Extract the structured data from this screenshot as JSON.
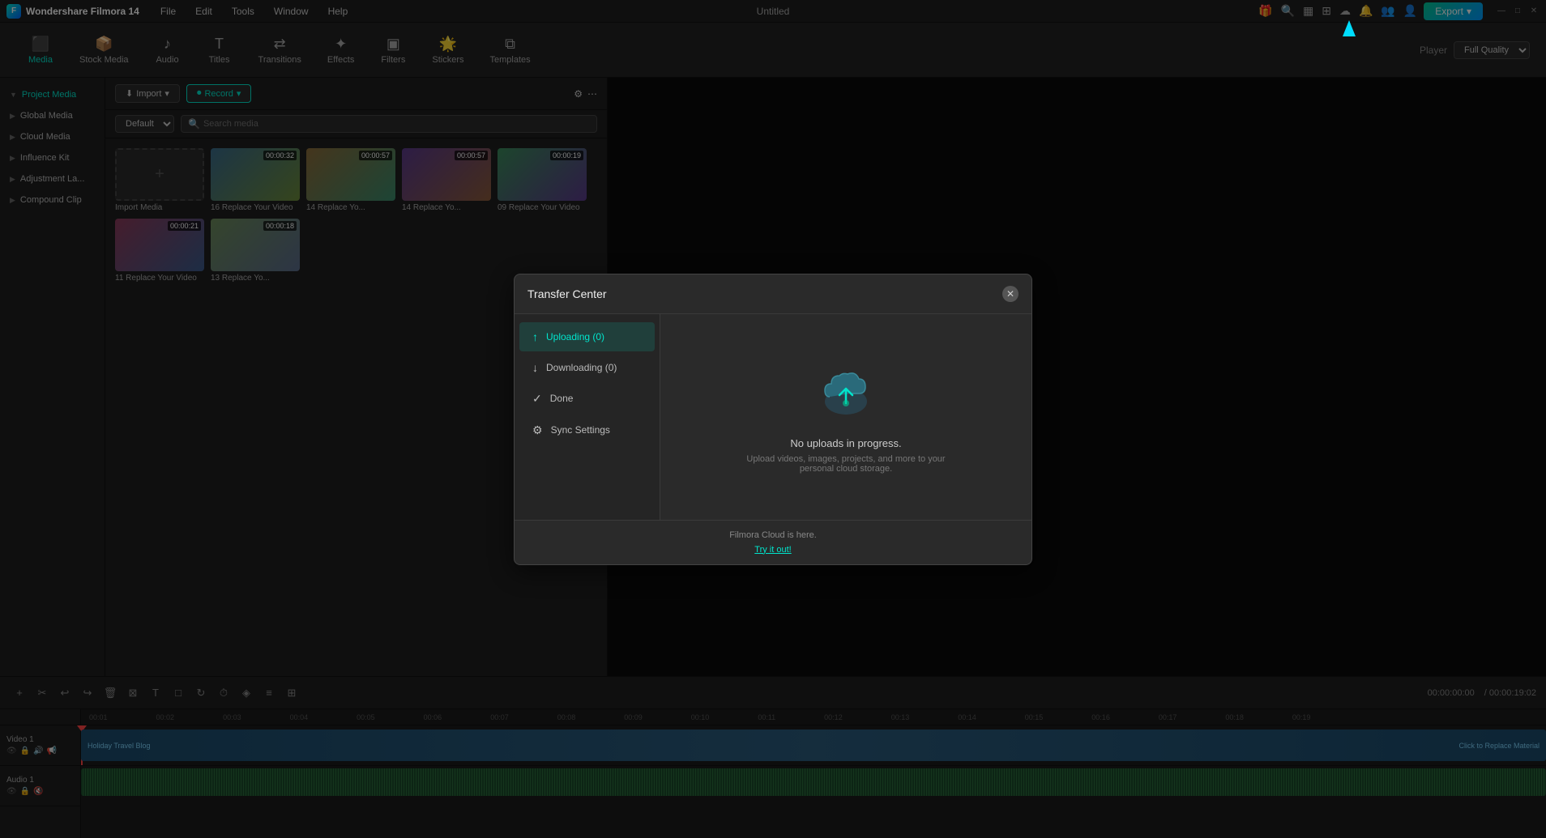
{
  "app": {
    "name": "Wondershare Filmora 14",
    "title": "Untitled"
  },
  "menubar": {
    "items": [
      "File",
      "Edit",
      "Tools",
      "Window",
      "Help"
    ]
  },
  "export_button": {
    "label": "Export"
  },
  "toolbar": {
    "tabs": [
      {
        "id": "media",
        "label": "Media",
        "icon": "⬛",
        "active": true
      },
      {
        "id": "stock-media",
        "label": "Stock Media",
        "icon": "📦"
      },
      {
        "id": "audio",
        "label": "Audio",
        "icon": "♪"
      },
      {
        "id": "titles",
        "label": "Titles",
        "icon": "T"
      },
      {
        "id": "transitions",
        "label": "Transitions",
        "icon": "⇄"
      },
      {
        "id": "effects",
        "label": "Effects",
        "icon": "✦"
      },
      {
        "id": "filters",
        "label": "Filters",
        "icon": "▣"
      },
      {
        "id": "stickers",
        "label": "Stickers",
        "icon": "🌟"
      },
      {
        "id": "templates",
        "label": "Templates",
        "icon": "⧉"
      }
    ],
    "player_label": "Player",
    "quality": "Full Quality"
  },
  "sidebar": {
    "items": [
      {
        "id": "project-media",
        "label": "Project Media",
        "active": true
      },
      {
        "id": "global-media",
        "label": "Global Media"
      },
      {
        "id": "cloud-media",
        "label": "Cloud Media"
      },
      {
        "id": "influence-kit",
        "label": "Influence Kit"
      },
      {
        "id": "adjustment-layer",
        "label": "Adjustment La..."
      },
      {
        "id": "compound-clip",
        "label": "Compound Clip"
      }
    ]
  },
  "media_panel": {
    "import_btn": "Import",
    "record_btn": "Record",
    "default_option": "Default",
    "search_placeholder": "Search media",
    "items": [
      {
        "label": "Import Media",
        "special": true
      },
      {
        "label": "16 Replace Your Video",
        "duration": "00:00:32",
        "gradient": 1
      },
      {
        "label": "14 Replace Yo...",
        "duration": "00:00:57",
        "gradient": 2
      },
      {
        "label": "14 Replace Yo...",
        "duration": "00:00:57",
        "gradient": 3
      },
      {
        "label": "09 Replace Your Video",
        "duration": "00:00:19",
        "gradient": 4
      },
      {
        "label": "11 Replace Your Video",
        "duration": "00:00:21",
        "gradient": 5
      },
      {
        "label": "13 Replace Yo...",
        "duration": "00:00:18",
        "gradient": 6
      }
    ]
  },
  "timeline": {
    "time_display": "00:00:00:00",
    "duration": "/ 00:00:19:02",
    "tracks": [
      {
        "name": "Video 1",
        "clip_label": "Holiday Travel Blog",
        "replace_text": "Click to Replace Material"
      },
      {
        "name": "Audio 1"
      }
    ],
    "ruler_marks": [
      "00:00:01:00",
      "00:00:02:00",
      "00:00:03:00",
      "00:00:04:00",
      "00:00:05:00",
      "00:00:06:00",
      "00:00:07:00",
      "00:00:08:00",
      "00:00:09:00",
      "00:00:10:00",
      "00:00:11:00",
      "00:00:12:00",
      "00:00:13:00",
      "00:00:14:00",
      "00:00:15:00",
      "00:00:16:00",
      "00:00:17:00",
      "00:00:18:00",
      "00:00:19:00"
    ]
  },
  "transfer_center": {
    "title": "Transfer Center",
    "tabs": [
      {
        "id": "uploading",
        "label": "Uploading (0)",
        "active": true
      },
      {
        "id": "downloading",
        "label": "Downloading (0)"
      },
      {
        "id": "done",
        "label": "Done"
      },
      {
        "id": "sync-settings",
        "label": "Sync Settings"
      }
    ],
    "empty_state": {
      "title": "No uploads in progress.",
      "subtitle": "Upload videos, images, projects, and more to your personal cloud storage."
    },
    "footer_text": "Filmora Cloud is here.",
    "footer_link": "Try it out!"
  }
}
